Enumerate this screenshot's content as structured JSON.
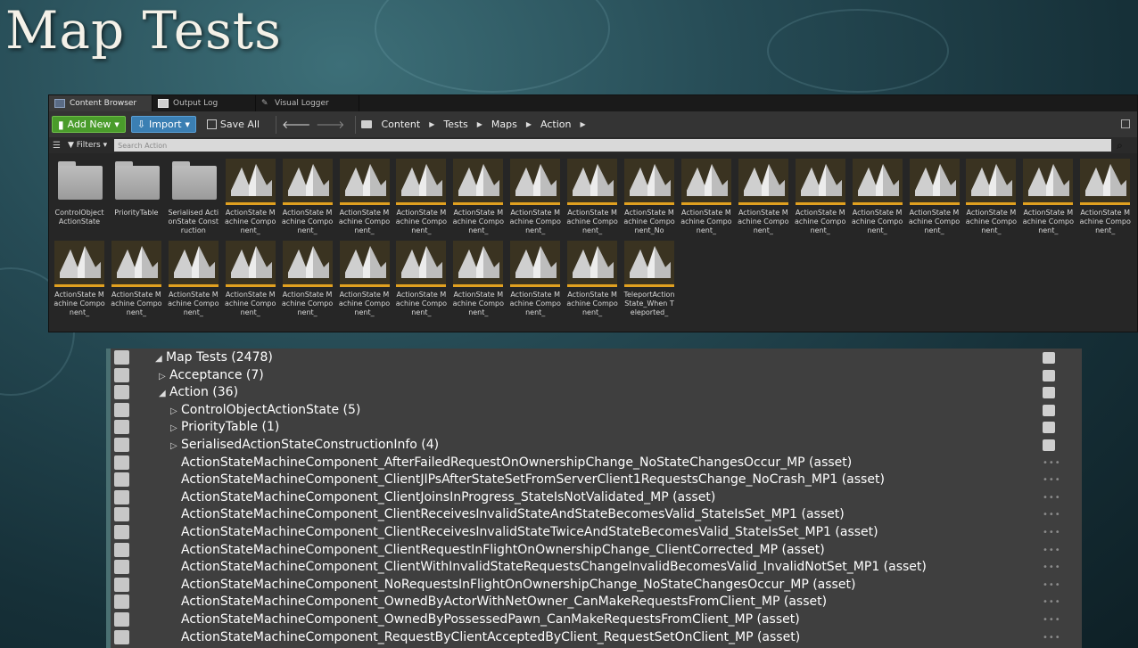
{
  "slide": {
    "title": "Map Tests"
  },
  "content_browser": {
    "tabs": [
      {
        "label": "Content Browser",
        "icon": "content-browser-icon"
      },
      {
        "label": "Output Log",
        "icon": "output-log-icon"
      },
      {
        "label": "Visual Logger",
        "icon": "visual-logger-icon"
      }
    ],
    "toolbar": {
      "add_new": "Add New",
      "import": "Import",
      "save_all": "Save All"
    },
    "breadcrumbs": [
      "Content",
      "Tests",
      "Maps",
      "Action"
    ],
    "filters_label": "Filters",
    "search_placeholder": "Search Action",
    "items": [
      {
        "type": "folder",
        "label": "ControlObject ActionState"
      },
      {
        "type": "folder",
        "label": "PriorityTable"
      },
      {
        "type": "folder",
        "label": "Serialised ActionState Construction"
      },
      {
        "type": "asset",
        "label": "ActionState Machine Component_"
      },
      {
        "type": "asset",
        "label": "ActionState Machine Component_"
      },
      {
        "type": "asset",
        "label": "ActionState Machine Component_"
      },
      {
        "type": "asset",
        "label": "ActionState Machine Component_"
      },
      {
        "type": "asset",
        "label": "ActionState Machine Component_"
      },
      {
        "type": "asset",
        "label": "ActionState Machine Component_"
      },
      {
        "type": "asset",
        "label": "ActionState Machine Component_"
      },
      {
        "type": "asset",
        "label": "ActionState Machine Component_No"
      },
      {
        "type": "asset",
        "label": "ActionState Machine Component_"
      },
      {
        "type": "asset",
        "label": "ActionState Machine Component_"
      },
      {
        "type": "asset",
        "label": "ActionState Machine Component_"
      },
      {
        "type": "asset",
        "label": "ActionState Machine Component_"
      },
      {
        "type": "asset",
        "label": "ActionState Machine Component_"
      },
      {
        "type": "asset",
        "label": "ActionState Machine Component_"
      },
      {
        "type": "asset",
        "label": "ActionState Machine Component_"
      },
      {
        "type": "asset",
        "label": "ActionState Machine Component_"
      },
      {
        "type": "asset",
        "label": "ActionState Machine Component_"
      },
      {
        "type": "asset",
        "label": "ActionState Machine Component_"
      },
      {
        "type": "asset",
        "label": "ActionState Machine Component_"
      },
      {
        "type": "asset",
        "label": "ActionState Machine Component_"
      },
      {
        "type": "asset",
        "label": "ActionState Machine Component_"
      },
      {
        "type": "asset",
        "label": "ActionState Machine Component_"
      },
      {
        "type": "asset",
        "label": "ActionState Machine Component_"
      },
      {
        "type": "asset",
        "label": "ActionState Machine Component_"
      },
      {
        "type": "asset",
        "label": "ActionState Machine Component_"
      },
      {
        "type": "asset",
        "label": "ActionState Machine Component_"
      },
      {
        "type": "asset",
        "label": "TeleportAction State_When Teleported_"
      }
    ]
  },
  "test_tree": {
    "rows": [
      {
        "label": "Map Tests (2478)",
        "depth": 0,
        "expander": "expanded",
        "right": "checkbox"
      },
      {
        "label": "Acceptance (7)",
        "depth": 1,
        "expander": "collapsed",
        "right": "checkbox"
      },
      {
        "label": "Action (36)",
        "depth": 1,
        "expander": "expanded",
        "right": "checkbox"
      },
      {
        "label": "ControlObjectActionState (5)",
        "depth": 2,
        "expander": "collapsed",
        "right": "checkbox"
      },
      {
        "label": "PriorityTable (1)",
        "depth": 2,
        "expander": "collapsed",
        "right": "checkbox"
      },
      {
        "label": "SerialisedActionStateConstructionInfo (4)",
        "depth": 2,
        "expander": "collapsed",
        "right": "checkbox"
      },
      {
        "label": "ActionStateMachineComponent_AfterFailedRequestOnOwnershipChange_NoStateChangesOccur_MP (asset)",
        "depth": 2,
        "expander": "none",
        "right": "dots"
      },
      {
        "label": "ActionStateMachineComponent_ClientJIPsAfterStateSetFromServerClient1RequestsChange_NoCrash_MP1 (asset)",
        "depth": 2,
        "expander": "none",
        "right": "dots"
      },
      {
        "label": "ActionStateMachineComponent_ClientJoinsInProgress_StateIsNotValidated_MP (asset)",
        "depth": 2,
        "expander": "none",
        "right": "dots"
      },
      {
        "label": "ActionStateMachineComponent_ClientReceivesInvalidStateAndStateBecomesValid_StateIsSet_MP1 (asset)",
        "depth": 2,
        "expander": "none",
        "right": "dots"
      },
      {
        "label": "ActionStateMachineComponent_ClientReceivesInvalidStateTwiceAndStateBecomesValid_StateIsSet_MP1 (asset)",
        "depth": 2,
        "expander": "none",
        "right": "dots"
      },
      {
        "label": "ActionStateMachineComponent_ClientRequestInFlightOnOwnershipChange_ClientCorrected_MP (asset)",
        "depth": 2,
        "expander": "none",
        "right": "dots"
      },
      {
        "label": "ActionStateMachineComponent_ClientWithInvalidStateRequestsChangeInvalidBecomesValid_InvalidNotSet_MP1 (asset)",
        "depth": 2,
        "expander": "none",
        "right": "dots"
      },
      {
        "label": "ActionStateMachineComponent_NoRequestsInFlightOnOwnershipChange_NoStateChangesOccur_MP (asset)",
        "depth": 2,
        "expander": "none",
        "right": "dots"
      },
      {
        "label": "ActionStateMachineComponent_OwnedByActorWithNetOwner_CanMakeRequestsFromClient_MP (asset)",
        "depth": 2,
        "expander": "none",
        "right": "dots"
      },
      {
        "label": "ActionStateMachineComponent_OwnedByPossessedPawn_CanMakeRequestsFromClient_MP (asset)",
        "depth": 2,
        "expander": "none",
        "right": "dots"
      },
      {
        "label": "ActionStateMachineComponent_RequestByClientAcceptedByClient_RequestSetOnClient_MP (asset)",
        "depth": 2,
        "expander": "none",
        "right": "dots"
      }
    ]
  },
  "colors": {
    "accent_green": "#4a9c2b",
    "accent_blue": "#3b7fb3",
    "asset_border": "#e0a020"
  }
}
